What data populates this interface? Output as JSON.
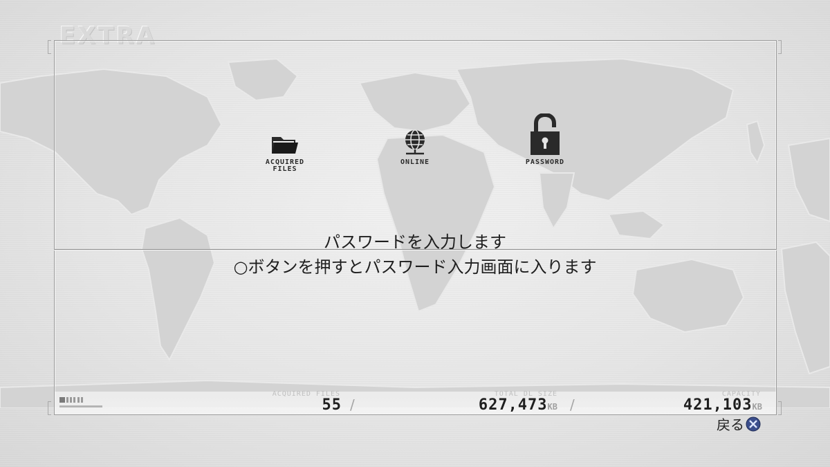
{
  "screen": {
    "title": "EXTRA"
  },
  "menu": {
    "items": [
      {
        "label": "ACQUIRED\nFILES",
        "icon": "folder-icon"
      },
      {
        "label": "ONLINE",
        "icon": "globe-network-icon"
      },
      {
        "label": "PASSWORD",
        "icon": "padlock-open-icon"
      }
    ],
    "selected_index": 2
  },
  "description": {
    "line1": "パスワードを入力します",
    "line2": "○ボタンを押すとパスワード入力画面に入ります"
  },
  "status": {
    "acquired_files_label": "ACQUIRED FILES",
    "acquired_files_value": "55",
    "total_dl_label": "TOTAL DL SIZE",
    "total_dl_value": "627,473",
    "total_dl_unit": "KB",
    "capacity_label": "CAPACITY",
    "capacity_value": "421,103",
    "capacity_unit": "KB",
    "separator": "/"
  },
  "footer": {
    "back_label": "戻る",
    "back_button_icon": "cross-button-icon"
  },
  "colors": {
    "background": "#e6e6e6",
    "text": "#1e1e1e",
    "frame": "#9a9a9a",
    "map": "#d2d2d2"
  }
}
